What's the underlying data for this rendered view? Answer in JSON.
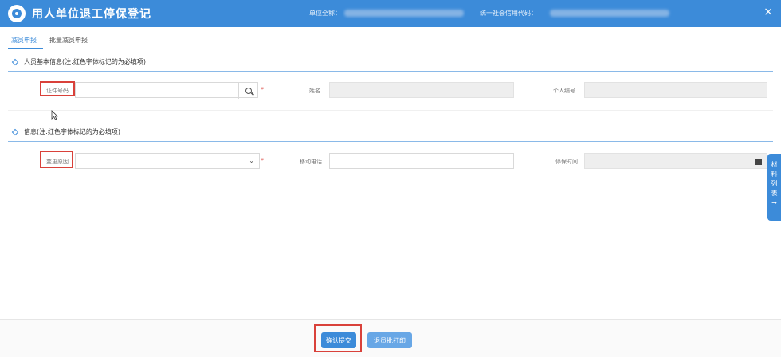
{
  "header": {
    "title": "用人单位退工停保登记",
    "unit_name_label": "单位全称：",
    "credit_code_label": "统一社会信用代码：",
    "close_glyph": "×"
  },
  "tabs": [
    "减员申报",
    "批量减员申报"
  ],
  "sections": {
    "basic_info": "人员基本信息(注:红色字体标记的为必填项)",
    "info": "信息(注:红色字体标记的为必填项)"
  },
  "form": {
    "id_number_label": "证件号码",
    "name_label": "姓名",
    "personal_no_label": "个人编号",
    "change_reason_label": "变更原因",
    "mobile_label": "移动电话",
    "stop_time_label": "停保时间",
    "required_mark": "*",
    "select_chevron": "⌄"
  },
  "side_tab": [
    "材",
    "料",
    "列",
    "表",
    "→"
  ],
  "footer": {
    "confirm_label": "确认提交",
    "print_label": "退员批打印"
  }
}
